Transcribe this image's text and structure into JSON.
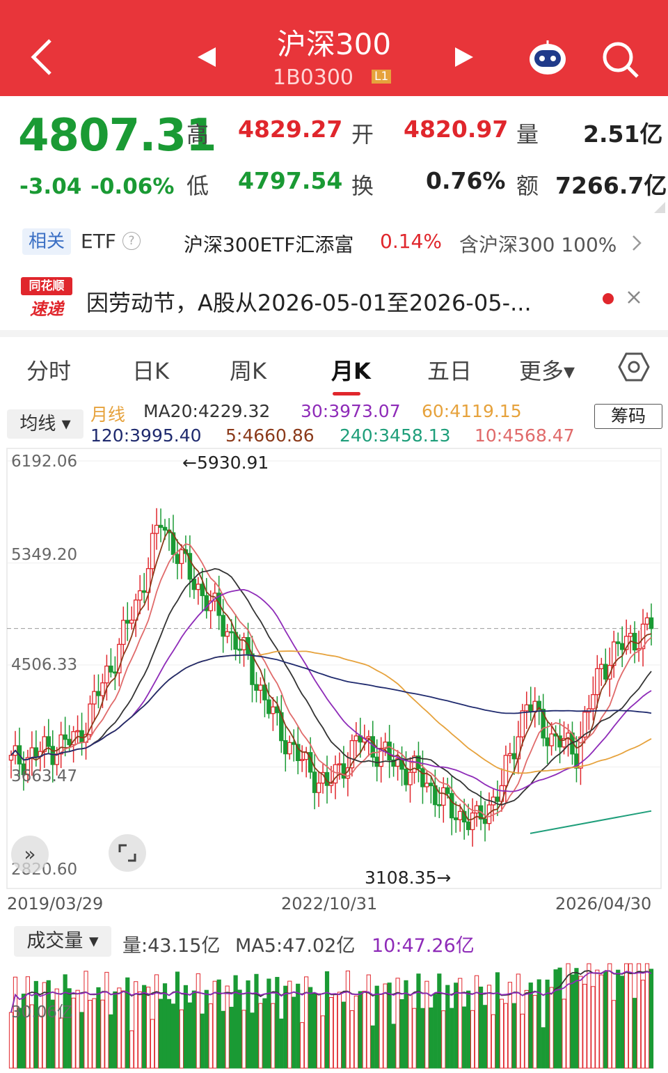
{
  "header": {
    "title": "沪深300",
    "code": "1B0300",
    "level_badge": "L1"
  },
  "quote": {
    "price": "4807.31",
    "change": "-3.04",
    "change_pct": "-0.06%",
    "high_label": "高",
    "high": "4829.27",
    "open_label": "开",
    "open": "4820.97",
    "volume_label": "量",
    "volume": "2.51亿",
    "low_label": "低",
    "low": "4797.54",
    "turnover_label": "换",
    "turnover": "0.76%",
    "amount_label": "额",
    "amount": "7266.7亿"
  },
  "etf": {
    "related_label": "相关",
    "etf_label": "ETF",
    "help_glyph": "?",
    "fund_name": "沪深300ETF汇添富",
    "fund_change": "0.14%",
    "contains_text": "含沪深300 100%"
  },
  "news": {
    "logo_top": "同花顺",
    "logo_bottom": "速递",
    "text": "因劳动节，A股从2026-05-01至2026-05-..."
  },
  "tabs": [
    {
      "label": "分时"
    },
    {
      "label": "日K"
    },
    {
      "label": "周K"
    },
    {
      "label": "月K"
    },
    {
      "label": "五日"
    },
    {
      "label": "更多▾"
    }
  ],
  "ma_bar": {
    "selector": "均线 ▾",
    "period": "月线",
    "ma20": "MA20:4229.32",
    "ma30": "30:3973.07",
    "ma60": "60:4119.15",
    "ma120": "120:3995.40",
    "ma5": "5:4660.86",
    "ma240": "240:3458.13",
    "ma10": "10:4568.47",
    "chips_button": "筹码"
  },
  "chart_data": {
    "type": "candlestick",
    "interval": "月K",
    "y_ticks": [
      "6192.06",
      "5349.20",
      "4506.33",
      "3663.47",
      "2820.60"
    ],
    "y_range": [
      2820.6,
      6192.06
    ],
    "x_ticks": [
      "2019/03/29",
      "2022/10/31",
      "2026/04/30"
    ],
    "max_annotation": "←5930.91",
    "min_annotation": "3108.35→",
    "last_close": 4807.31,
    "colors": {
      "up": "#e0262c",
      "down": "#1a9a34",
      "ma5": "#8b3a1a",
      "ma10": "#e06a6a",
      "ma20": "#333333",
      "ma30": "#8e2bb8",
      "ma60": "#e6a23c",
      "ma120": "#1f2a6e",
      "ma240": "#1e9e7a"
    }
  },
  "volume": {
    "selector": "成交量 ▾",
    "vol": "量:43.15亿",
    "ma5": "MA5:47.02亿",
    "ma10": "10:47.26亿",
    "axis_label": "30.06亿"
  }
}
